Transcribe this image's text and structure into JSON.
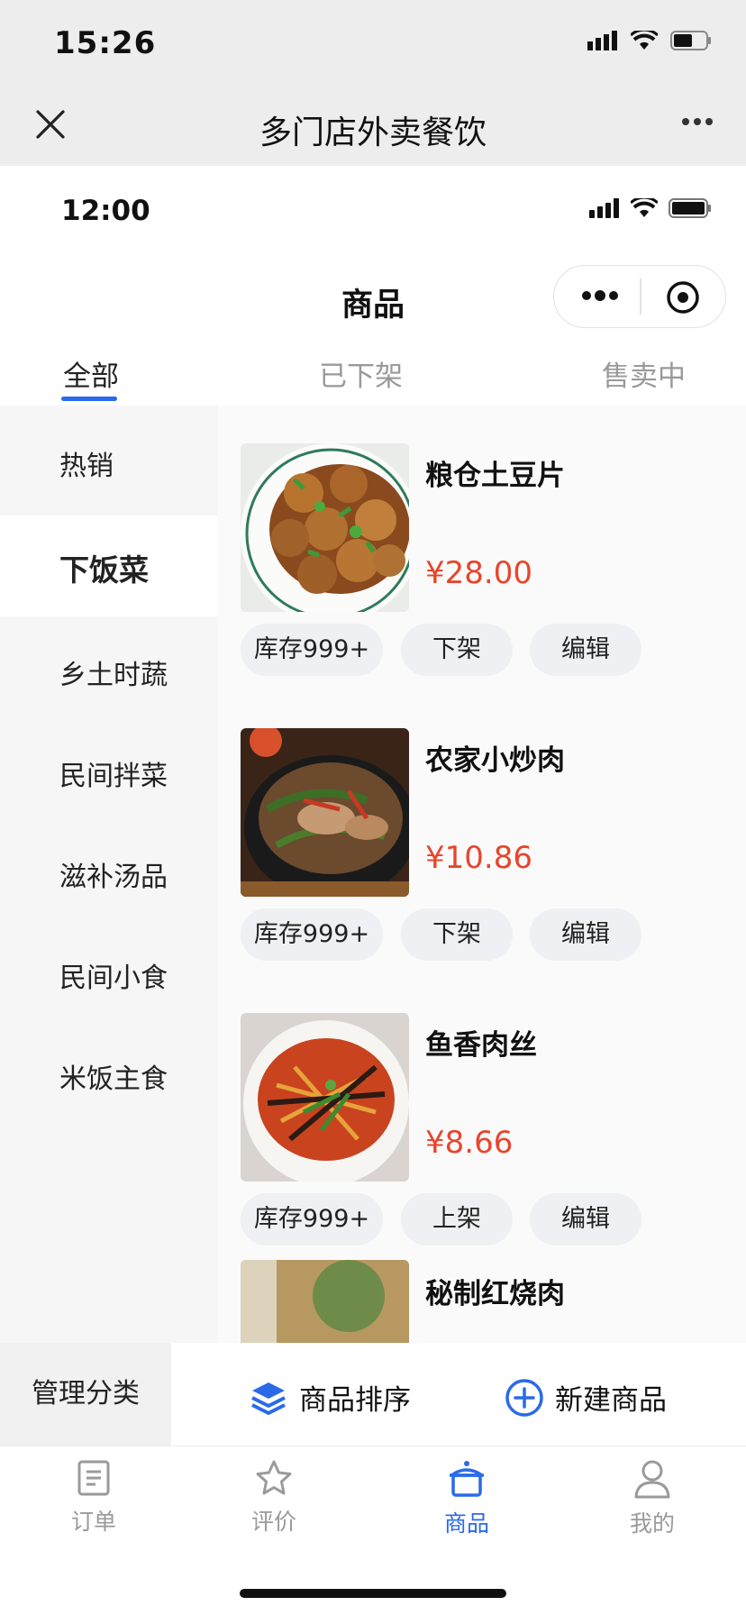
{
  "os_status": {
    "time": "15:26"
  },
  "outer_nav": {
    "title": "多门店外卖餐饮"
  },
  "inner_status": {
    "time": "12:00"
  },
  "page": {
    "title": "商品"
  },
  "tabs": [
    {
      "label": "全部",
      "active": true
    },
    {
      "label": "已下架",
      "active": false
    },
    {
      "label": "售卖中",
      "active": false
    }
  ],
  "sidebar": {
    "items": [
      {
        "label": "热销"
      },
      {
        "label": "下饭菜",
        "active": true
      },
      {
        "label": "乡土时蔬"
      },
      {
        "label": "民间拌菜"
      },
      {
        "label": "滋补汤品"
      },
      {
        "label": "民间小食"
      },
      {
        "label": "米饭主食"
      }
    ]
  },
  "products": [
    {
      "name": "粮仓土豆片",
      "price": "¥28.00",
      "stock": "库存999+",
      "toggle": "下架",
      "edit": "编辑"
    },
    {
      "name": "农家小炒肉",
      "price": "¥10.86",
      "stock": "库存999+",
      "toggle": "下架",
      "edit": "编辑"
    },
    {
      "name": "鱼香肉丝",
      "price": "¥8.66",
      "stock": "库存999+",
      "toggle": "上架",
      "edit": "编辑"
    },
    {
      "name": "秘制红烧肉"
    }
  ],
  "actionbar": {
    "manage": "管理分类",
    "sort": "商品排序",
    "create": "新建商品"
  },
  "tabbar": [
    {
      "label": "订单",
      "icon": "order-icon"
    },
    {
      "label": "评价",
      "icon": "star-icon"
    },
    {
      "label": "商品",
      "icon": "goods-icon",
      "active": true
    },
    {
      "label": "我的",
      "icon": "user-icon"
    }
  ],
  "colors": {
    "accent": "#2a6ae9",
    "price": "#e8452c"
  }
}
